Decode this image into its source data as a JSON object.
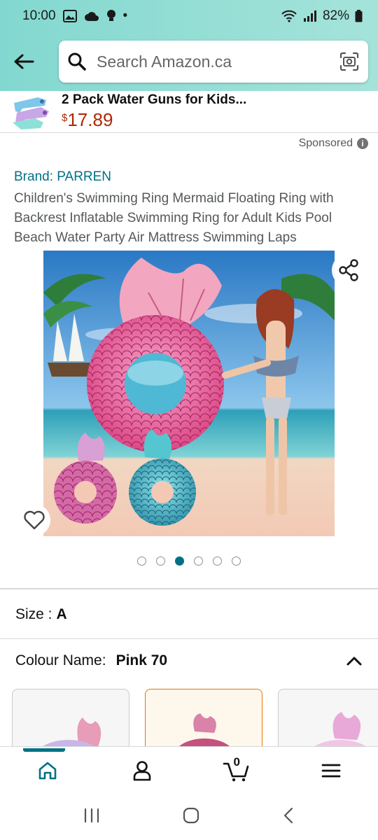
{
  "status_bar": {
    "time": "10:00",
    "battery": "82%",
    "dot": "•"
  },
  "header": {
    "search_placeholder": "Search Amazon.ca"
  },
  "sponsored_product": {
    "title": "2 Pack Water Guns for Kids...",
    "price_currency": "$",
    "price": "17.89"
  },
  "sponsored_label": "Sponsored",
  "product": {
    "brand": "Brand: PARREN",
    "title": "Children's Swimming Ring Mermaid Floating Ring with Backrest Inflatable Swimming Ring for Adult Kids Pool Beach Water Party Air Mattress Swimming Laps",
    "image_count": 6,
    "active_image_index": 2
  },
  "size": {
    "label": "Size :",
    "value": "A"
  },
  "colour": {
    "label": "Colour Name:",
    "value": "Pink 70"
  },
  "colour_swatches": [
    {
      "name": "Iridescent",
      "selected": false
    },
    {
      "name": "Pink 70",
      "selected": true
    },
    {
      "name": "Light Pink",
      "selected": false
    }
  ],
  "bottom_nav": {
    "cart_count": "0"
  },
  "colors": {
    "accent": "#007185",
    "price": "#b12704",
    "header_bg": "#82d8d0",
    "selected_border": "#e77600"
  }
}
